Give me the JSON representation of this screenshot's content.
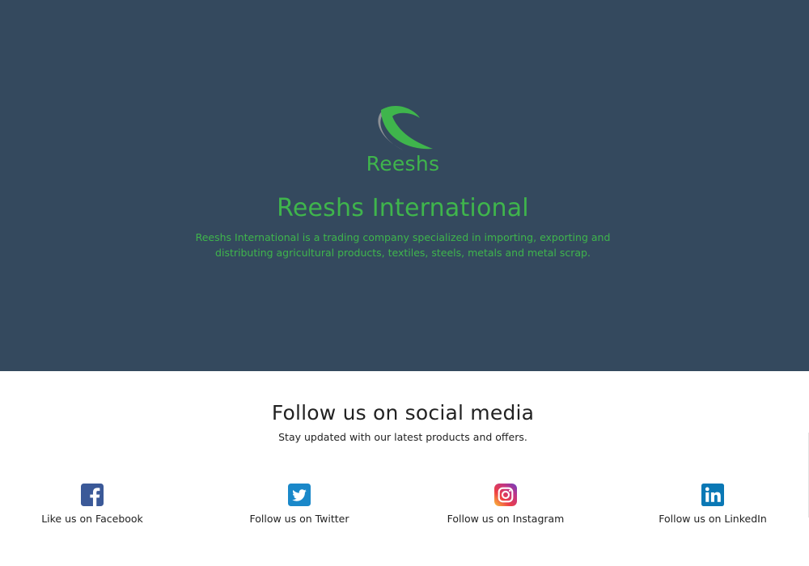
{
  "brand": {
    "logo_text": "Reeshs",
    "title": "Reeshs International",
    "description": "Reeshs International is a trading company specialized in importing, exporting and distributing agricultural products, textiles, steels, metals and metal scrap.",
    "accent_color": "#3fb54c",
    "hero_bg_color": "#34495e"
  },
  "social": {
    "title": "Follow us on social media",
    "subtitle": "Stay updated with our latest products and offers.",
    "items": [
      {
        "label": "Like us on Facebook",
        "icon": "facebook-icon",
        "color": "#3b5998"
      },
      {
        "label": "Follow us on Twitter",
        "icon": "twitter-icon",
        "color": "#1a88c9"
      },
      {
        "label": "Follow us on Instagram",
        "icon": "instagram-icon",
        "color": "#c13584"
      },
      {
        "label": "Follow us on LinkedIn",
        "icon": "linkedin-icon",
        "color": "#0a78b5"
      }
    ]
  }
}
